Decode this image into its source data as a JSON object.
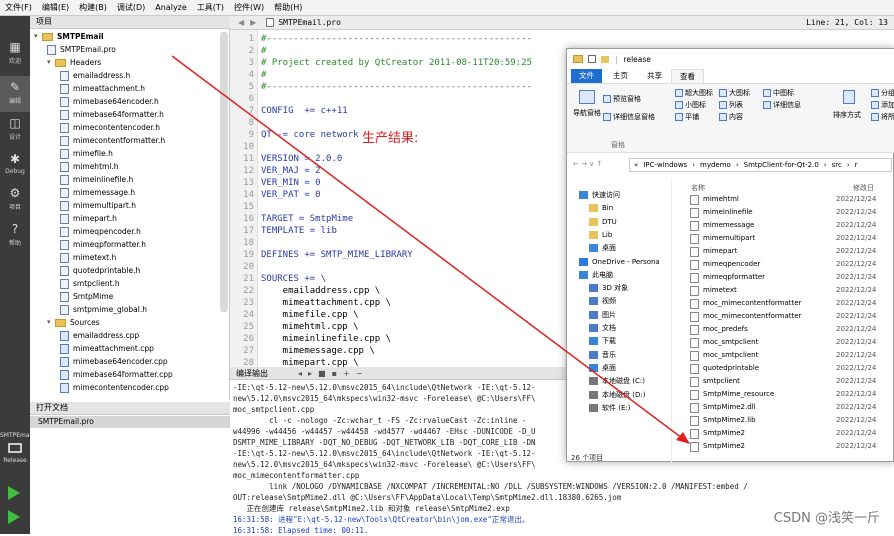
{
  "menubar": {
    "items": [
      "文件(F)",
      "编辑(E)",
      "构建(B)",
      "调试(D)",
      "Analyze",
      "工具(T)",
      "控件(W)",
      "帮助(H)"
    ]
  },
  "modes": [
    {
      "label": "欢迎",
      "icon": "grid-icon"
    },
    {
      "label": "编辑",
      "icon": "edit-icon"
    },
    {
      "label": "设计",
      "icon": "design-icon"
    },
    {
      "label": "Debug",
      "icon": "bug-icon"
    },
    {
      "label": "项目",
      "icon": "wrench-icon"
    },
    {
      "label": "帮助",
      "icon": "help-icon"
    }
  ],
  "kit": {
    "project": "SMTPEmail",
    "mode": "Release"
  },
  "project_panel": {
    "title": "项目"
  },
  "tree": [
    {
      "label": "SMTPEmail",
      "type": "project",
      "indent": 0
    },
    {
      "label": "SMTPEmail.pro",
      "type": "pro",
      "indent": 1
    },
    {
      "label": "Headers",
      "type": "folder",
      "indent": 1
    },
    {
      "label": "emailaddress.h",
      "type": "h",
      "indent": 2
    },
    {
      "label": "mimeattachment.h",
      "type": "h",
      "indent": 2
    },
    {
      "label": "mimebase64encoder.h",
      "type": "h",
      "indent": 2
    },
    {
      "label": "mimebase64formatter.h",
      "type": "h",
      "indent": 2
    },
    {
      "label": "mimecontentencoder.h",
      "type": "h",
      "indent": 2
    },
    {
      "label": "mimecontentformatter.h",
      "type": "h",
      "indent": 2
    },
    {
      "label": "mimefile.h",
      "type": "h",
      "indent": 2
    },
    {
      "label": "mimehtml.h",
      "type": "h",
      "indent": 2
    },
    {
      "label": "mimeinlinefile.h",
      "type": "h",
      "indent": 2
    },
    {
      "label": "mimemessage.h",
      "type": "h",
      "indent": 2
    },
    {
      "label": "mimemultipart.h",
      "type": "h",
      "indent": 2
    },
    {
      "label": "mimepart.h",
      "type": "h",
      "indent": 2
    },
    {
      "label": "mimeqpencoder.h",
      "type": "h",
      "indent": 2
    },
    {
      "label": "mimeqpformatter.h",
      "type": "h",
      "indent": 2
    },
    {
      "label": "mimetext.h",
      "type": "h",
      "indent": 2
    },
    {
      "label": "quotedprintable.h",
      "type": "h",
      "indent": 2
    },
    {
      "label": "smtpclient.h",
      "type": "h",
      "indent": 2
    },
    {
      "label": "SmtpMime",
      "type": "h",
      "indent": 2
    },
    {
      "label": "smtpmime_global.h",
      "type": "h",
      "indent": 2
    },
    {
      "label": "Sources",
      "type": "folder",
      "indent": 1
    },
    {
      "label": "emailaddress.cpp",
      "type": "cpp",
      "indent": 2
    },
    {
      "label": "mimeattachment.cpp",
      "type": "cpp",
      "indent": 2
    },
    {
      "label": "mimebase64encoder.cpp",
      "type": "cpp",
      "indent": 2
    },
    {
      "label": "mimebase64formatter.cpp",
      "type": "cpp",
      "indent": 2
    },
    {
      "label": "mimecontentencoder.cpp",
      "type": "cpp",
      "indent": 2
    }
  ],
  "open_docs": {
    "title": "打开文档",
    "items": [
      "SMTPEmail.pro"
    ]
  },
  "editor": {
    "file": "SMTPEmail.pro",
    "cursor": "Line: 21, Col: 13",
    "lines": [
      {
        "n": "1",
        "text": "#-------------------------------------------------",
        "cls": "cm"
      },
      {
        "n": "2",
        "text": "#",
        "cls": "cm"
      },
      {
        "n": "3",
        "text": "# Project created by QtCreator 2011-08-11T20:59:25",
        "cls": "cm"
      },
      {
        "n": "4",
        "text": "#",
        "cls": "cm"
      },
      {
        "n": "5",
        "text": "#-------------------------------------------------",
        "cls": "cm"
      },
      {
        "n": "6",
        "text": "",
        "cls": ""
      },
      {
        "n": "7",
        "text": "CONFIG  += c++11",
        "cls": "kw"
      },
      {
        "n": "8",
        "text": "",
        "cls": ""
      },
      {
        "n": "9",
        "text": "QT -= core network",
        "cls": "kw"
      },
      {
        "n": "10",
        "text": "",
        "cls": ""
      },
      {
        "n": "11",
        "text": "VERSION = 2.0.0",
        "cls": "kw"
      },
      {
        "n": "12",
        "text": "VER_MAJ = 2",
        "cls": "kw"
      },
      {
        "n": "13",
        "text": "VER_MIN = 0",
        "cls": "kw"
      },
      {
        "n": "14",
        "text": "VER_PAT = 0",
        "cls": "kw"
      },
      {
        "n": "15",
        "text": "",
        "cls": ""
      },
      {
        "n": "16",
        "text": "TARGET = SmtpMime",
        "cls": "kw"
      },
      {
        "n": "17",
        "text": "TEMPLATE = lib",
        "cls": "kw"
      },
      {
        "n": "18",
        "text": "",
        "cls": ""
      },
      {
        "n": "19",
        "text": "DEFINES += SMTP_MIME_LIBRARY",
        "cls": "kw"
      },
      {
        "n": "20",
        "text": "",
        "cls": ""
      },
      {
        "n": "21",
        "text": "SOURCES += \\",
        "cls": "kw"
      },
      {
        "n": "22",
        "text": "    emailaddress.cpp \\",
        "cls": ""
      },
      {
        "n": "23",
        "text": "    mimeattachment.cpp \\",
        "cls": ""
      },
      {
        "n": "24",
        "text": "    mimefile.cpp \\",
        "cls": ""
      },
      {
        "n": "25",
        "text": "    mimehtml.cpp \\",
        "cls": ""
      },
      {
        "n": "26",
        "text": "    mimeinlinefile.cpp \\",
        "cls": ""
      },
      {
        "n": "27",
        "text": "    mimemessage.cpp \\",
        "cls": ""
      },
      {
        "n": "28",
        "text": "    mimepart.cpp \\",
        "cls": ""
      }
    ]
  },
  "annotation": "生产结果:",
  "output": {
    "title": "编译输出",
    "lines": [
      {
        "text": "-IE:\\qt-5.12-new\\5.12.0\\msvc2015_64\\include\\QtNetwork -IE:\\qt-5.12-",
        "blue": false
      },
      {
        "text": "new\\5.12.0\\msvc2015_64\\mkspecs\\win32-msvc -Forelease\\ @C:\\Users\\FF\\",
        "blue": false
      },
      {
        "text": "moc_smtpclient.cpp",
        "blue": false
      },
      {
        "text": "        cl -c -nologo -Zc:wchar_t -FS -Zc:rvalueCast -Zc:inline -",
        "blue": false
      },
      {
        "text": "w44996 -w44456 -w44457 -w44458 -wd4577 -wd4467 -EHsc -DUNICODE -D_U",
        "blue": false
      },
      {
        "text": "DSMTP_MIME_LIBRARY -DQT_NO_DEBUG -DQT_NETWORK_LIB -DQT_CORE_LIB -DN",
        "blue": false
      },
      {
        "text": "-IE:\\qt-5.12-new\\5.12.0\\msvc2015_64\\include\\QtNetwork -IE:\\qt-5.12-",
        "blue": false
      },
      {
        "text": "new\\5.12.0\\msvc2015_64\\mkspecs\\win32-msvc -Forelease\\ @C:\\Users\\FF\\",
        "blue": false
      },
      {
        "text": "moc_mimecontentformatter.cpp",
        "blue": false
      },
      {
        "text": "        link /NOLOGO /DYNAMICBASE /NXCOMPAT /INCREMENTAL:NO /DLL /SUBSYSTEM:WINDOWS /VERSION:2.0 /MANIFEST:embed /",
        "blue": false
      },
      {
        "text": "OUT:release\\SmtpMime2.dll @C:\\Users\\FF\\AppData\\Local\\Temp\\SmtpMime2.dll.18380.6265.jom",
        "blue": false
      },
      {
        "text": "   正在创建库 release\\SmtpMime2.lib 和对象 release\\SmtpMime2.exp",
        "blue": false
      },
      {
        "text": "16:31:58: 进程\"E:\\qt-5.12-new\\Tools\\QtCreator\\bin\\jom.exe\"正常退出。",
        "blue": true
      },
      {
        "text": "16:31:58: Elapsed time: 00:11.",
        "blue": true
      }
    ]
  },
  "explorer": {
    "title": "release",
    "tabs": [
      "文件",
      "主页",
      "共享",
      "查看"
    ],
    "ribbon": {
      "nav_pane": "导航窗格",
      "preview": "预览窗格",
      "details": "详细信息窗格",
      "group_panes": "窗格",
      "layout": [
        "超大图标",
        "大图标",
        "中图标",
        "小图标",
        "列表",
        "详细信息",
        "平铺",
        "内容"
      ],
      "sort": "排序方式",
      "right": [
        "分组",
        "添加",
        "将所"
      ]
    },
    "address": [
      "«",
      "IPC-windows",
      "›",
      "mydemo",
      "›",
      "SmtpClient-for-Qt-2.0",
      "›",
      "src",
      "›",
      "r"
    ],
    "columns": {
      "name": "名称",
      "date": "修改日"
    },
    "nav": [
      "快速访问",
      "Bin",
      "DTU",
      "Lib",
      "桌面",
      "OneDrive - Persona",
      "此电脑",
      "3D 对象",
      "视频",
      "图片",
      "文档",
      "下载",
      "音乐",
      "桌面",
      "本地磁盘 (C:)",
      "本地磁盘 (D:)",
      "软件 (E:)"
    ],
    "count": "26 个项目",
    "files": [
      {
        "name": "mimehtml",
        "date": "2022/12/24"
      },
      {
        "name": "mimeinlinefile",
        "date": "2022/12/24"
      },
      {
        "name": "mimemessage",
        "date": "2022/12/24"
      },
      {
        "name": "mimemultipart",
        "date": "2022/12/24"
      },
      {
        "name": "mimepart",
        "date": "2022/12/24"
      },
      {
        "name": "mimeqpencoder",
        "date": "2022/12/24"
      },
      {
        "name": "mimeqpformatter",
        "date": "2022/12/24"
      },
      {
        "name": "mimetext",
        "date": "2022/12/24"
      },
      {
        "name": "moc_mimecontentformatter",
        "date": "2022/12/24"
      },
      {
        "name": "moc_mimecontentformatter",
        "date": "2022/12/24"
      },
      {
        "name": "moc_predefs",
        "date": "2022/12/24"
      },
      {
        "name": "moc_smtpclient",
        "date": "2022/12/24"
      },
      {
        "name": "moc_smtpclient",
        "date": "2022/12/24"
      },
      {
        "name": "quotedprintable",
        "date": "2022/12/24"
      },
      {
        "name": "smtpclient",
        "date": "2022/12/24"
      },
      {
        "name": "SmtpMime_resource",
        "date": "2022/12/24"
      },
      {
        "name": "SmtpMime2.dll",
        "date": "2022/12/24"
      },
      {
        "name": "SmtpMime2.lib",
        "date": "2022/12/24"
      },
      {
        "name": "SmtpMime2",
        "date": "2022/12/24"
      },
      {
        "name": "SmtpMime2",
        "date": "2022/12/24"
      }
    ]
  },
  "watermark": "CSDN @浅笑一斤",
  "colors": {
    "accent": "#e02020",
    "ribbon_file_tab": "#1f6fd0"
  }
}
